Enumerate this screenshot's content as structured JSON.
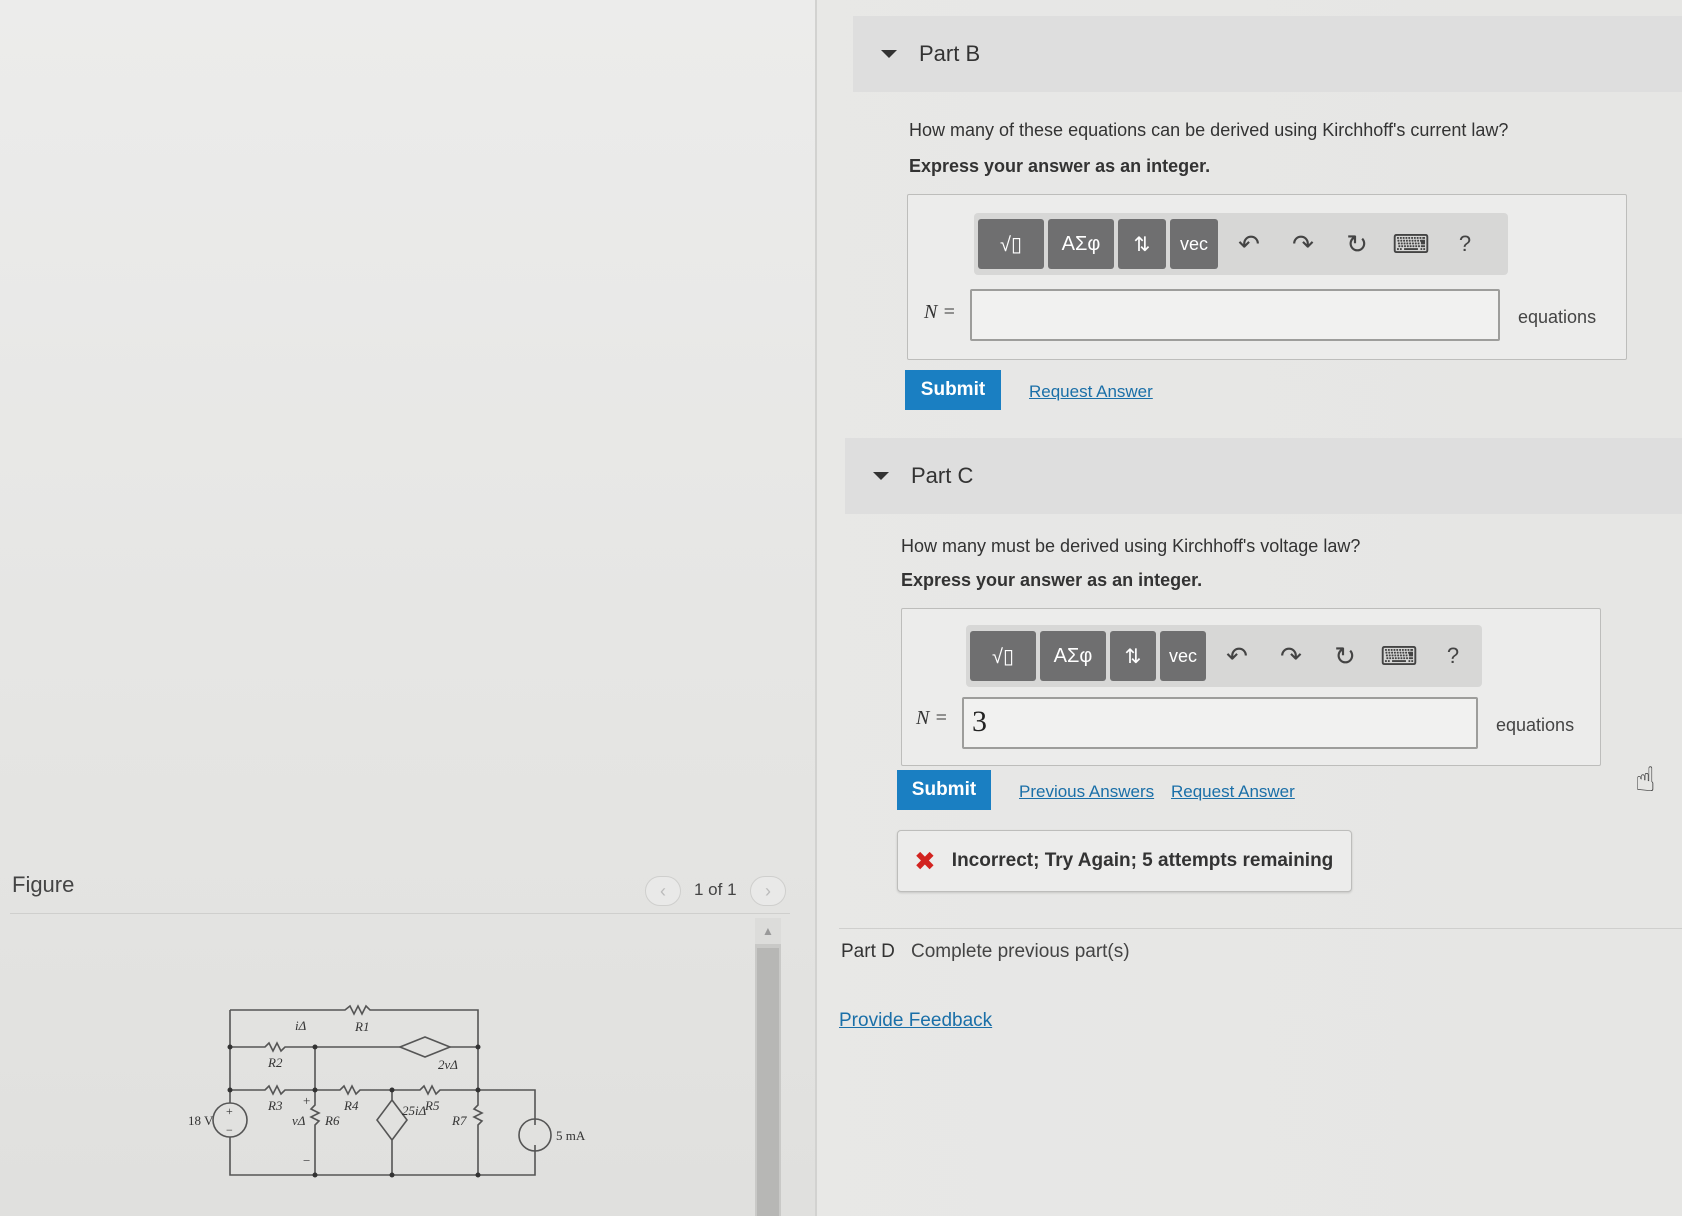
{
  "figure": {
    "label": "Figure",
    "pager_text": "1 of 1",
    "circuit_labels": {
      "source_voltage": "18 V",
      "current_source": "5 mA",
      "r1": "R1",
      "r2": "R2",
      "r3": "R3",
      "r4": "R4",
      "r5": "R5",
      "r6": "R6",
      "r7": "R7",
      "i_delta": "iΔ",
      "v_delta": "vΔ",
      "dep_current": "2vΔ",
      "dep_voltage": "25iΔ",
      "plus": "+",
      "minus": "−"
    }
  },
  "part_b": {
    "title": "Part B",
    "question": "How many of these equations can be derived using Kirchhoff's current law?",
    "instruction": "Express your answer as an integer.",
    "toolbar": {
      "templates": "√▯",
      "greek": "ΑΣφ",
      "arrows": "⇅",
      "vec": "vec",
      "help": "?"
    },
    "var_label": "N =",
    "input_value": "",
    "units": "equations",
    "submit_label": "Submit",
    "request_answer": "Request Answer"
  },
  "part_c": {
    "title": "Part C",
    "question": "How many must be derived using Kirchhoff's voltage law?",
    "instruction": "Express your answer as an integer.",
    "toolbar": {
      "templates": "√▯",
      "greek": "ΑΣφ",
      "arrows": "⇅",
      "vec": "vec",
      "help": "?"
    },
    "var_label": "N =",
    "input_value": "3",
    "units": "equations",
    "submit_label": "Submit",
    "previous_answers": "Previous Answers",
    "request_answer": "Request Answer",
    "feedback": "Incorrect; Try Again; 5 attempts remaining"
  },
  "part_d": {
    "title": "Part D",
    "status": "Complete previous part(s)"
  },
  "provide_feedback": "Provide Feedback",
  "colors": {
    "accent": "#1a7fc2",
    "error": "#d2231f",
    "link": "#1a6fa8"
  },
  "icons": [
    "templates-icon",
    "greek-icon",
    "arrows-icon",
    "undo-icon",
    "redo-icon",
    "reset-icon",
    "keyboard-icon",
    "help-icon",
    "error-x-icon",
    "hand-cursor-icon"
  ]
}
